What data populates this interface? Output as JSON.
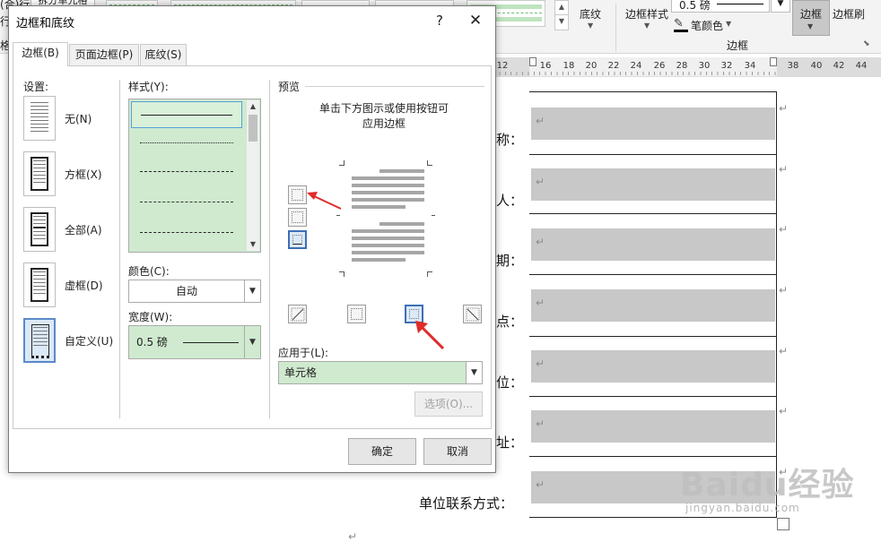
{
  "ribbon": {
    "partial_labels": [
      "(合)行",
      "行",
      "格"
    ],
    "partial_button": "拆分单元格",
    "shading_label": "底纹",
    "border_styles_label": "边框样式",
    "pen_weight_value": "0.5 磅",
    "pen_color_label": "笔颜色",
    "borders_button_label": "边框",
    "border_painter_label": "边框刷",
    "group_label": "边框"
  },
  "ruler": {
    "numbers": [
      "12",
      "16",
      "18",
      "20",
      "22",
      "24",
      "26",
      "28",
      "30",
      "32",
      "34",
      "38",
      "40",
      "42",
      "44"
    ]
  },
  "document": {
    "labels": [
      "称：",
      "人：",
      "期：",
      "点：",
      "位：",
      "址：",
      "单位联系方式："
    ],
    "paragraph_mark": "↵"
  },
  "dialog": {
    "title": "边框和底纹",
    "help_glyph": "?",
    "close_glyph": "✕",
    "tabs": [
      {
        "label": "边框(B)",
        "active": true
      },
      {
        "label": "页面边框(P)",
        "active": false
      },
      {
        "label": "底纹(S)",
        "active": false
      }
    ],
    "settings_title": "设置:",
    "settings": [
      {
        "label": "无(N)",
        "icon": "none-border-icon",
        "selected": false
      },
      {
        "label": "方框(X)",
        "icon": "box-border-icon",
        "selected": false
      },
      {
        "label": "全部(A)",
        "icon": "all-border-icon",
        "selected": false
      },
      {
        "label": "虚框(D)",
        "icon": "grid-border-icon",
        "selected": false
      },
      {
        "label": "自定义(U)",
        "icon": "custom-border-icon",
        "selected": true
      }
    ],
    "style_title": "样式(Y):",
    "style_items": [
      "solid",
      "dotted",
      "dashed",
      "long-dashed",
      "dash-dot"
    ],
    "color_title": "颜色(C):",
    "color_value": "自动",
    "width_title": "宽度(W):",
    "width_value": "0.5 磅",
    "preview_title": "预览",
    "preview_hint_line1": "单击下方图示或使用按钮可",
    "preview_hint_line2": "应用边框",
    "apply_to_title": "应用于(L):",
    "apply_to_value": "单元格",
    "options_button": "选项(O)...",
    "ok_button": "确定",
    "cancel_button": "取消"
  },
  "watermark": {
    "main": "Baidu经验",
    "sub": "jingyan.baidu.com"
  },
  "colors": {
    "accent_green": "#cfeacf",
    "selection_blue": "#3c6fb6",
    "arrow_red": "#e02b2b",
    "cell_gray": "#c8c8c8"
  }
}
